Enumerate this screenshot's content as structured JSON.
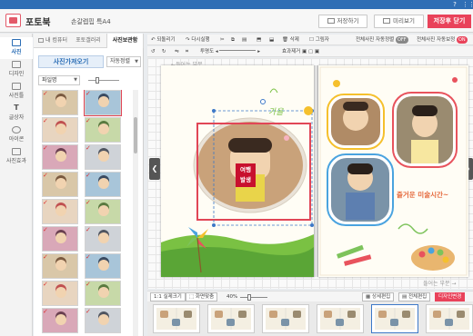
{
  "topbar": {
    "help_icon": "help-icon",
    "grid_icon": "grid-menu-icon"
  },
  "header": {
    "app_name": "포토북",
    "doc_name": "손갈렙핍 특A4",
    "save_label": "저장하기",
    "preview_label": "미리보기",
    "close_label": "저장후 닫기"
  },
  "leftnav": {
    "items": [
      {
        "label": "사진",
        "icon": "photo-icon",
        "active": true
      },
      {
        "label": "디자인",
        "icon": "design-icon"
      },
      {
        "label": "사진틀",
        "icon": "frame-icon"
      },
      {
        "label": "글상자",
        "icon": "textbox-icon"
      },
      {
        "label": "아이콘",
        "icon": "clipart-icon"
      },
      {
        "label": "사진효과",
        "icon": "effect-icon"
      }
    ]
  },
  "panel": {
    "tabs": [
      "내 컴퓨터",
      "포토갤러리",
      "사진보관함"
    ],
    "import_label": "사진가져오기",
    "sort_label": "자동정렬",
    "filename_label": "파일명"
  },
  "toolbar1": {
    "items": [
      "되돌리기",
      "다시실행",
      "복사",
      "붙이기",
      "맨앞",
      "앞으로",
      "뒤로",
      "맨뒤",
      "그림자"
    ],
    "auto_sort_label": "전체사진 자동정렬",
    "auto_sort_state": "OFF",
    "auto_save_label": "전체사진 자동보정",
    "auto_save_state": "ON"
  },
  "toolbar2": {
    "transparency_label": "투명도",
    "effect_label": "효과제거"
  },
  "canvas": {
    "left_gutter": "←들어는 부분",
    "right_gutter": "들어는 부분 →",
    "page_left": {
      "badge_line1": "여행",
      "badge_line2": "발생",
      "deco_text": "가을"
    },
    "page_right": {
      "deco_text": "즐거운 미술시간~"
    }
  },
  "bottombar": {
    "fit_label": "1:1 실제크기",
    "fitscreen_label": "화면맞춤",
    "zoom": "40%",
    "detail_label": "상세편집",
    "all_label": "전체편집",
    "design_change_label": "디자인변경"
  },
  "colors": {
    "accent": "#e9425a",
    "brand_blue": "#2f6eb5"
  }
}
